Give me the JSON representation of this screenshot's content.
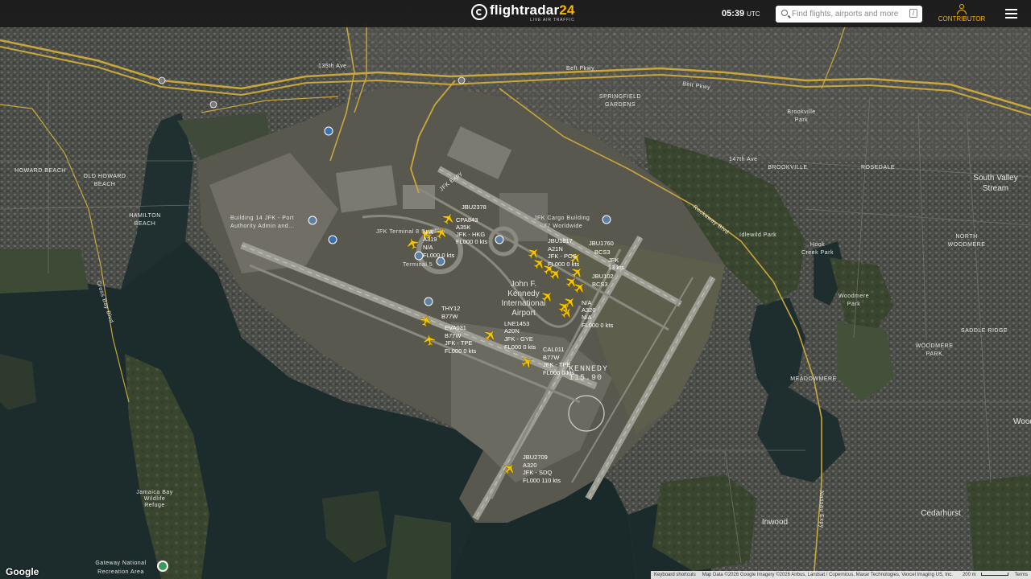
{
  "brand": {
    "name_main": "flightradar",
    "name_num": "24",
    "tagline": "LIVE AIR TRAFFIC",
    "accent": "#f7b500"
  },
  "clock": {
    "time": "05:39",
    "zone": "UTC"
  },
  "search": {
    "placeholder": "Find flights, airports and more",
    "shortcut": "/"
  },
  "account": {
    "label": "CONTRIBUTOR"
  },
  "map_labels": {
    "airport_name_1": "John F.",
    "airport_name_2": "Kennedy",
    "airport_name_3": "International",
    "airport_name_4": "Airport",
    "vor_name": "KENNEDY",
    "vor_freq": "115.90",
    "building_14_1": "Building 14 JFK - Port",
    "building_14_2": "Authority Admin and...",
    "cargo_1": "JFK Cargo Building",
    "cargo_2": "77 Worldwide",
    "springfield_1": "SPRINGFIELD",
    "springfield_2": "GARDENS",
    "brookville": "BROOKVILLE",
    "rosedale": "ROSEDALE",
    "south_valley_1": "South Valley",
    "south_valley_2": "Stream",
    "north_woodmere_1": "NORTH",
    "north_woodmere_2": "WOODMERE",
    "woodmere_park_label": "Woodmere",
    "woodmere_park_label2": "Park",
    "saddle_ridge": "SADDLE RIDGE",
    "woodmere_1": "WOODMERE",
    "woodmere_2": "PARK",
    "meadowmere": "MEADOWMERE",
    "inwood": "Inwood",
    "cedarhurst": "Cedarhurst",
    "woodmere_edge": "Wood",
    "howard_beach": "HOWARD BEACH",
    "old_howard_1": "OLD HOWARD",
    "old_howard_2": "BEACH",
    "hamilton_1": "HAMILTON",
    "hamilton_2": "BEACH",
    "gateway_1": "Gateway National",
    "gateway_2": "Recreation Area",
    "jamaica_1": "Jamaica Bay",
    "jamaica_2": "Wildlife",
    "jamaica_3": "Refuge",
    "idlewild": "Idlewild Park",
    "hook_creek_1": "Hook",
    "hook_creek_2": "Creek Park",
    "brookville_park_1": "Brookville",
    "brookville_park_2": "Park",
    "belt_pkwy": "Belt Pkwy",
    "belt_pkwy_2": "Belt Pkwy",
    "rockaway_blvd": "Rockaway Blvd",
    "cross_bay": "Cross Bay Blvd",
    "nassau_expy": "Nassau Expy",
    "ave_135": "135th Ave",
    "jfk_expy": "JFK Expy",
    "ave_147": "147th Ave",
    "terminal_8": "JFK Terminal 8 Satellite",
    "terminal_5": "Terminal 5"
  },
  "flights": [
    {
      "callsign": "JBU2378",
      "aircraft": "",
      "route": "",
      "alt": ""
    },
    {
      "callsign": "CPA843",
      "aircraft": "A35K",
      "route": "JFK - HKG",
      "alt": "FL000 0 kts"
    },
    {
      "callsign": "N/A",
      "aircraft": "A319",
      "route": "N/A",
      "alt": "FL000 0 kts"
    },
    {
      "callsign": "JBU1817",
      "aircraft": "A21N",
      "route": "JFK - POS",
      "alt": "FL000 0 kts"
    },
    {
      "callsign": "JBU1760",
      "aircraft": "BCS3",
      "route": "JFK",
      "alt": "13 kts"
    },
    {
      "callsign": "JBU102",
      "aircraft": "BCS3",
      "route": "",
      "alt": ""
    },
    {
      "callsign": "N/A",
      "aircraft": "A320",
      "route": "N/A",
      "alt": "FL000 0 kts"
    },
    {
      "callsign": "THY12",
      "aircraft": "B77W",
      "route": "",
      "alt": ""
    },
    {
      "callsign": "EVA031",
      "aircraft": "B77W",
      "route": "JFK - TPE",
      "alt": "FL000 0 kts"
    },
    {
      "callsign": "LNE1453",
      "aircraft": "A20N",
      "route": "JFK - GYE",
      "alt": "FL000 0 kts"
    },
    {
      "callsign": "CAL011",
      "aircraft": "B77W",
      "route": "JFK - TPE",
      "alt": "FL000 0 kts"
    },
    {
      "callsign": "JBU2709",
      "aircraft": "A320",
      "route": "JFK - SDQ",
      "alt": "FL000 110 kts"
    }
  ],
  "attribution": {
    "shortcuts": "Keyboard shortcuts",
    "data": "Map Data ©2026 Google Imagery ©2026 Airbus, Landsat / Copernicus, Maxar Technologies, Vexcel Imaging US, Inc.",
    "scale": "200 m",
    "terms": "Terms"
  },
  "google": "Google"
}
